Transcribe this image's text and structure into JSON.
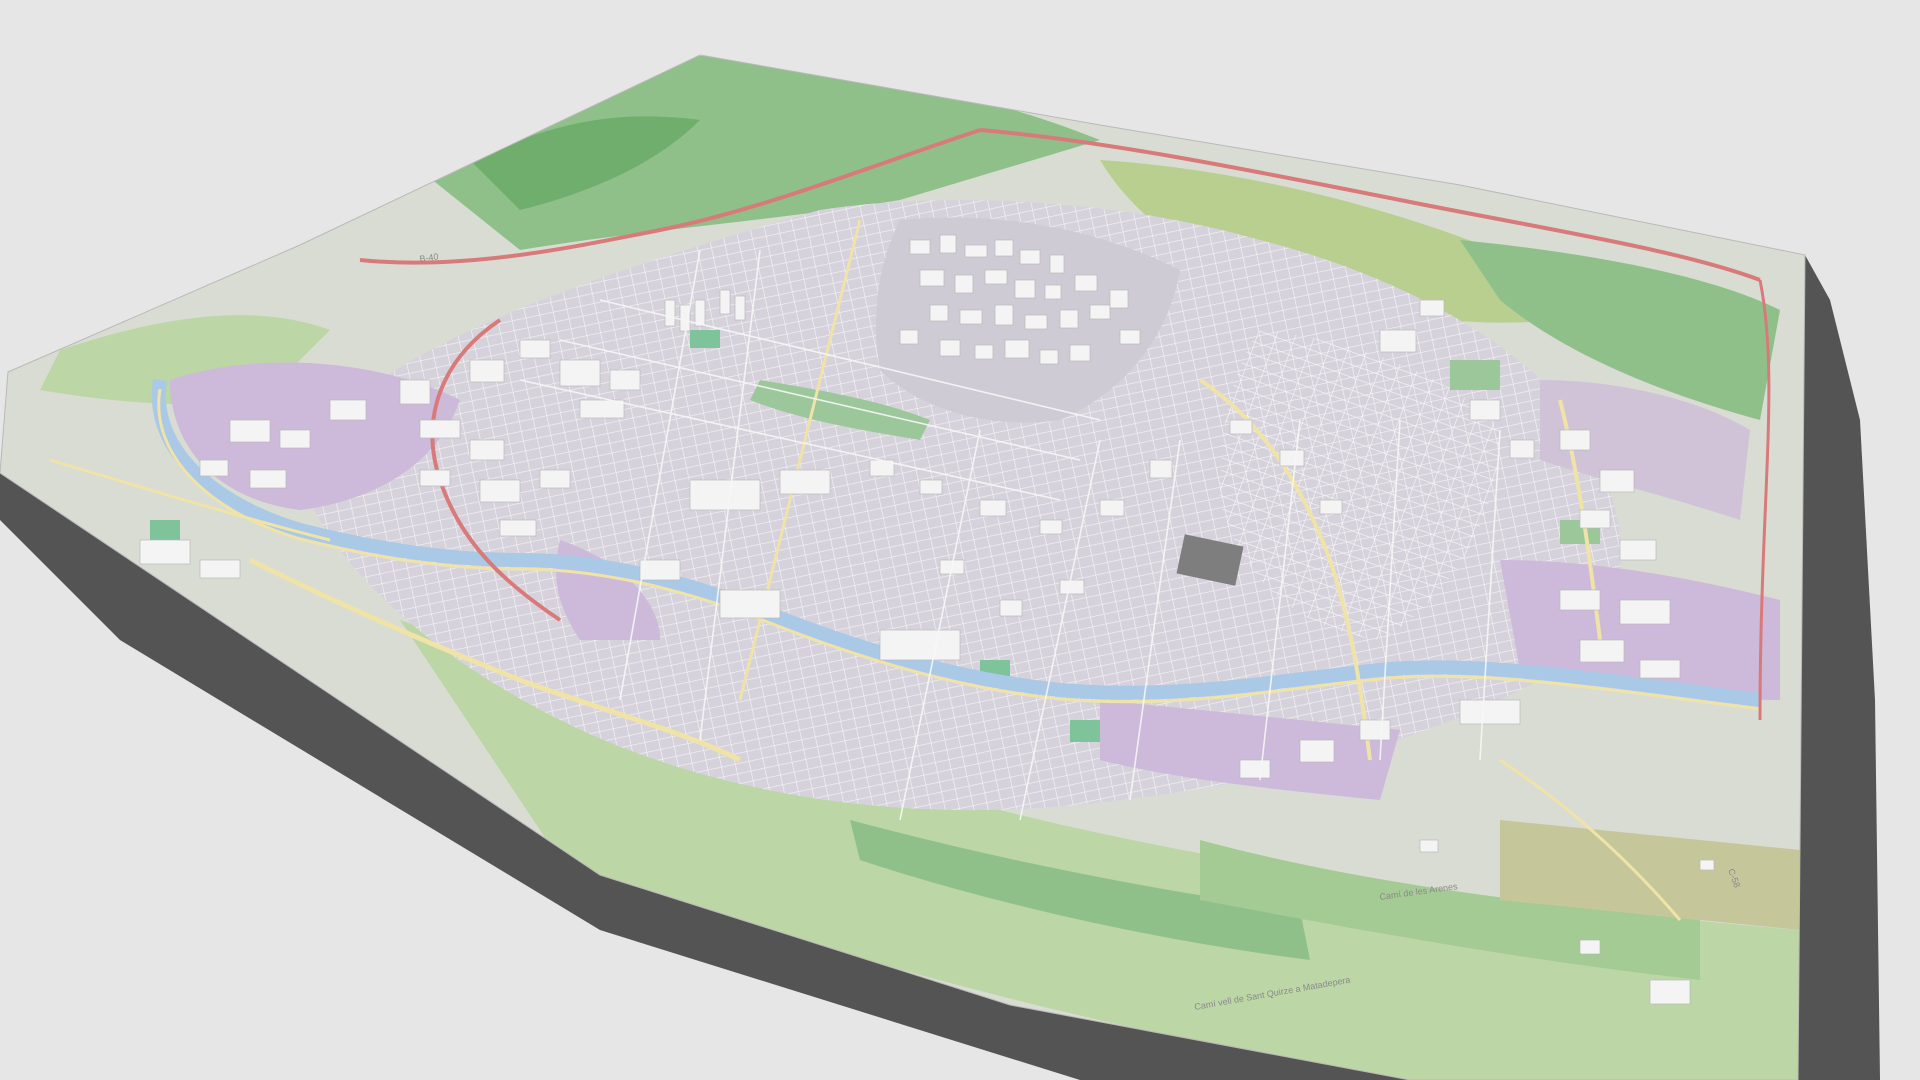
{
  "scene": {
    "type": "3d-city-map-model",
    "background_color": "#e6e6e6",
    "colors": {
      "base_land": "#d9dcd3",
      "urban": "#d6d2dc",
      "residential_purple": "#cdb9d9",
      "park_green": "#9cc79a",
      "forest_green": "#7fb77a",
      "field_green": "#bcd6a6",
      "olive": "#c5c79a",
      "river": "#a9c9e6",
      "highway_red": "#d87a7a",
      "highway_yellow": "#efe3a7",
      "street_white": "#f7f7f7",
      "building": "#f2f2f2",
      "shadow": "#333333"
    }
  },
  "labels": {
    "road_1": "Camí vell de Sant Quirze a Matadepera",
    "road_2": "Camí de les Arenes",
    "road_3": "C-58",
    "road_4": "B-40"
  }
}
